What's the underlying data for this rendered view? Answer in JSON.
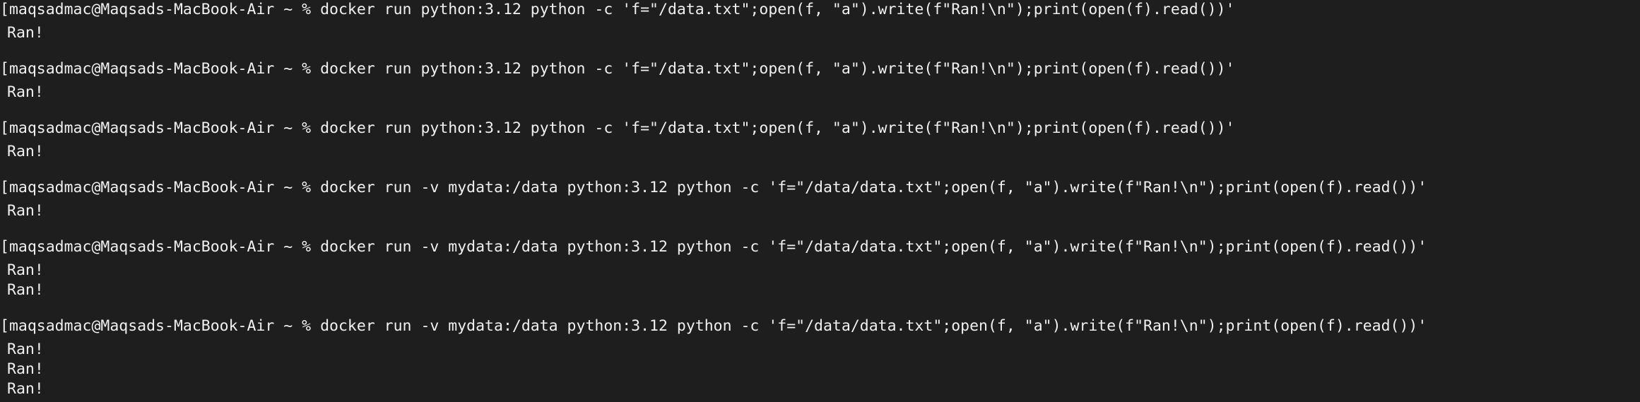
{
  "terminal": {
    "prompt": "maqsadmac@Maqsads-MacBook-Air ~ % ",
    "lines": [
      {
        "kind": "prompt",
        "bracket": "[",
        "prompt": "maqsadmac@Maqsads-MacBook-Air ~ % ",
        "command": "docker run python:3.12 python -c 'f=\"/data.txt\";open(f, \"a\").write(f\"Ran!\\n\");print(open(f).read())'"
      },
      {
        "kind": "output",
        "text": "Ran!"
      },
      {
        "kind": "prompt",
        "bracket": "[",
        "prompt": "maqsadmac@Maqsads-MacBook-Air ~ % ",
        "command": "docker run python:3.12 python -c 'f=\"/data.txt\";open(f, \"a\").write(f\"Ran!\\n\");print(open(f).read())'"
      },
      {
        "kind": "output",
        "text": "Ran!"
      },
      {
        "kind": "prompt",
        "bracket": "[",
        "prompt": "maqsadmac@Maqsads-MacBook-Air ~ % ",
        "command": "docker run python:3.12 python -c 'f=\"/data.txt\";open(f, \"a\").write(f\"Ran!\\n\");print(open(f).read())'"
      },
      {
        "kind": "output",
        "text": "Ran!"
      },
      {
        "kind": "prompt",
        "bracket": "[",
        "prompt": "maqsadmac@Maqsads-MacBook-Air ~ % ",
        "command": "docker run -v mydata:/data python:3.12 python -c 'f=\"/data/data.txt\";open(f, \"a\").write(f\"Ran!\\n\");print(open(f).read())'"
      },
      {
        "kind": "output",
        "text": "Ran!"
      },
      {
        "kind": "prompt",
        "bracket": "[",
        "prompt": "maqsadmac@Maqsads-MacBook-Air ~ % ",
        "command": "docker run -v mydata:/data python:3.12 python -c 'f=\"/data/data.txt\";open(f, \"a\").write(f\"Ran!\\n\");print(open(f).read())'"
      },
      {
        "kind": "output",
        "text": "Ran!"
      },
      {
        "kind": "output",
        "text": "Ran!"
      },
      {
        "kind": "prompt",
        "bracket": "[",
        "prompt": "maqsadmac@Maqsads-MacBook-Air ~ % ",
        "command": "docker run -v mydata:/data python:3.12 python -c 'f=\"/data/data.txt\";open(f, \"a\").write(f\"Ran!\\n\");print(open(f).read())'"
      },
      {
        "kind": "output",
        "text": "Ran!"
      },
      {
        "kind": "output",
        "text": "Ran!"
      },
      {
        "kind": "output",
        "text": "Ran!"
      }
    ]
  }
}
